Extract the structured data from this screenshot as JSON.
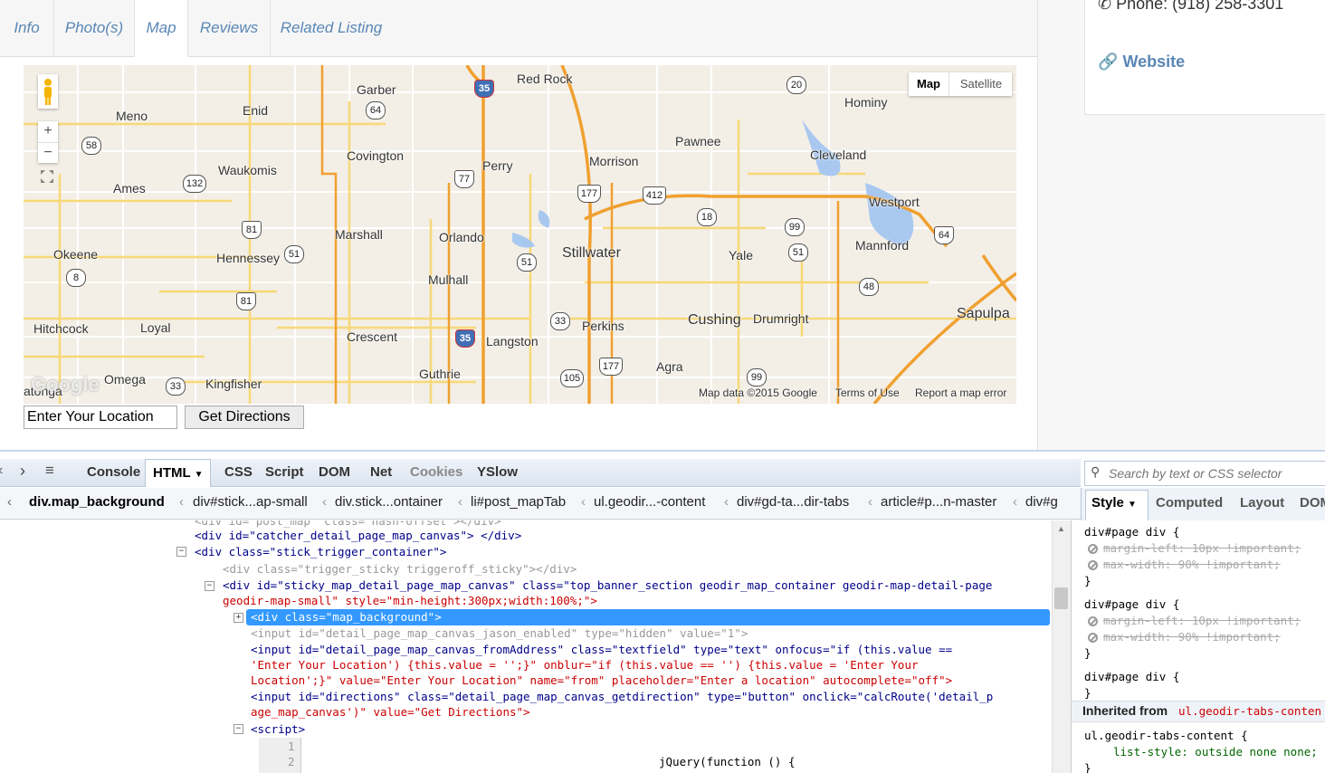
{
  "tabs": [
    "Info",
    "Photo(s)",
    "Map",
    "Reviews",
    "Related Listing"
  ],
  "active_tab": "Map",
  "contact": {
    "phone": "Phone: (918) 258-3301",
    "website": "Website"
  },
  "map": {
    "type_buttons": [
      "Map",
      "Satellite"
    ],
    "zoom_in": "+",
    "zoom_out": "−",
    "towns": [
      "Red Rock",
      "Garber",
      "Meno",
      "Enid",
      "Covington",
      "Perry",
      "Pawnee",
      "Morrison",
      "Hominy",
      "Cleveland",
      "Waukomis",
      "Ames",
      "Westport",
      "Marshall",
      "Orlando",
      "Mannford",
      "Okeene",
      "Hennessey",
      "Stillwater",
      "Yale",
      "Mulhall",
      "Hitchcock",
      "Loyal",
      "Crescent",
      "Langston",
      "Perkins",
      "Cushing",
      "Drumright",
      "Sapulpa",
      "Guthrie",
      "Agra",
      "Omega",
      "Kingfisher",
      "atonga"
    ],
    "shields": [
      "35",
      "64",
      "20",
      "58",
      "132",
      "77",
      "177",
      "412",
      "18",
      "99",
      "81",
      "51",
      "64",
      "51",
      "48",
      "81",
      "8",
      "33",
      "35",
      "177",
      "105",
      "99",
      "33",
      "51"
    ],
    "footer": [
      "Map data ©2015 Google",
      "Terms of Use",
      "Report a map error"
    ],
    "watermark": "Google"
  },
  "location_input": {
    "value": "Enter Your Location"
  },
  "directions_button": "Get Directions",
  "devtools": {
    "tabs": [
      "Console",
      "HTML",
      "CSS",
      "Script",
      "DOM",
      "Net",
      "Cookies",
      "YSlow"
    ],
    "active_tab": "HTML",
    "search_placeholder": "Search by text or CSS selector",
    "breadcrumb": [
      "div.map_background",
      "div#stick...ap-small",
      "div.stick...ontainer",
      "li#post_mapTab",
      "ul.geodir...-content",
      "div#gd-ta...dir-tabs",
      "article#p...n-master",
      "div#g"
    ],
    "side_tabs": [
      "Style",
      "Computed",
      "Layout",
      "DOM"
    ],
    "tree_lines": [
      "<div id=\"post_map\" class=\"hash-offset\"></div>",
      "<div id=\"catcher_detail_page_map_canvas\"> </div>",
      "<div class=\"stick_trigger_container\">",
      "<div class=\"trigger_sticky triggeroff_sticky\"></div>",
      "<div id=\"sticky_map_detail_page_map_canvas\" class=\"top_banner_section geodir_map_container geodir-map-detail-page",
      "geodir-map-small\" style=\"min-height:300px;width:100%;\">",
      "<div class=\"map_background\">",
      "<input id=\"detail_page_map_canvas_jason_enabled\" type=\"hidden\" value=\"1\">",
      "<input id=\"detail_page_map_canvas_fromAddress\" class=\"textfield\" type=\"text\" onfocus=\"if (this.value ==",
      "'Enter Your Location') {this.value = '';}\" onblur=\"if (this.value == '') {this.value = 'Enter Your",
      "Location';}\" value=\"Enter Your Location\" name=\"from\" placeholder=\"Enter a location\" autocomplete=\"off\">",
      "<input id=\"directions\" class=\"detail_page_map_canvas_getdirection\" type=\"button\" onclick=\"calcRoute('detail_p",
      "age_map_canvas')\" value=\"Get Directions\">",
      "<script>",
      "jQuery(function () {"
    ],
    "line_numbers": [
      "1",
      "2"
    ],
    "style_pane": {
      "rule1": "div#page div {",
      "rule1_props": [
        "margin-left: 10px !important;",
        "max-width: 90% !important;"
      ],
      "close": "}",
      "rule2": "div#page div {",
      "rule2_props": [
        "margin-left: 10px !important;",
        "max-width: 90% !important;"
      ],
      "rule3": "div#page div {",
      "inherited_label": "Inherited from",
      "inherited_from": "ul.geodir-tabs-conten",
      "rule4": "ul.geodir-tabs-content {",
      "rule4_prop": "list-style: outside none none;"
    }
  },
  "colors": {
    "link": "#5a87b5",
    "selection": "#3399ff",
    "road_orange": "#f0a030",
    "road_yellow": "#f8d878",
    "water": "#a8c8f0"
  }
}
